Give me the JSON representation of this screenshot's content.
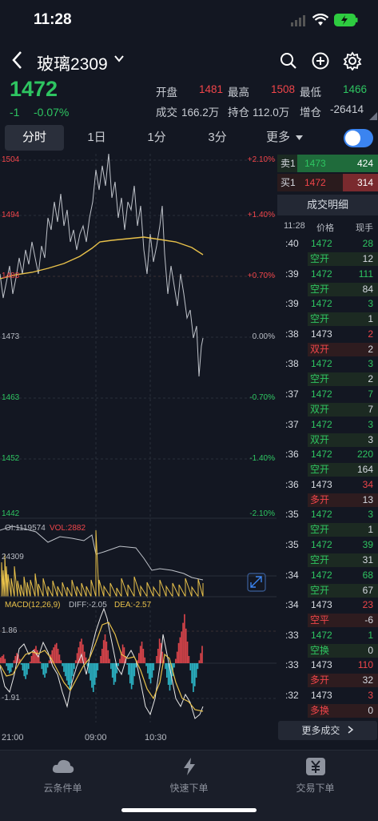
{
  "status": {
    "time": "11:28"
  },
  "header": {
    "title": "玻璃2309"
  },
  "quote": {
    "last": "1472",
    "change": "-1",
    "change_pct": "-0.07%",
    "open_label": "开盘",
    "open": "1481",
    "high_label": "最高",
    "high": "1508",
    "low_label": "最低",
    "low": "1466",
    "vol_label": "成交",
    "vol": "166.2万",
    "oi_label": "持仓",
    "oi": "112.0万",
    "oi_chg_label": "增仓",
    "oi_chg": "-26414"
  },
  "tabs": [
    "分时",
    "1日",
    "1分",
    "3分",
    "更多"
  ],
  "chart": {
    "left_ticks": [
      "1504",
      "1494",
      "1483",
      "1473",
      "1463",
      "1452",
      "1442"
    ],
    "right_ticks": [
      "+2.10%",
      "+1.40%",
      "+0.70%",
      "0.00%",
      "-0.70%",
      "-1.40%",
      "-2.10%"
    ],
    "vol_oi_label": "OI:1119574",
    "vol_label": "VOL:2882",
    "vol_axis": "24309",
    "macd_label": "MACD(12,26,9)",
    "diff_label": "DIFF:-2.05",
    "dea_label": "DEA:-2.57",
    "macd_top": "1.86",
    "macd_bottom": "-1.91",
    "time_labels": [
      "21:00",
      "09:00",
      "10:30"
    ]
  },
  "orderbook": {
    "ask_label": "卖1",
    "ask_price": "1473",
    "ask_vol": "424",
    "bid_label": "买1",
    "bid_price": "1472",
    "bid_vol": "314"
  },
  "trades": {
    "title": "成交明细",
    "time_head": "11:28",
    "price_head": "价格",
    "qty_head": "现手",
    "rows": [
      {
        "t": ":40",
        "p": "1472",
        "pc": "g",
        "q": "28",
        "qc": "g",
        "k": "空开",
        "kc": "g",
        "o": "12"
      },
      {
        "t": ":39",
        "p": "1472",
        "pc": "g",
        "q": "111",
        "qc": "g",
        "k": "空开",
        "kc": "g",
        "o": "84"
      },
      {
        "t": ":39",
        "p": "1472",
        "pc": "g",
        "q": "3",
        "qc": "g",
        "k": "空开",
        "kc": "g",
        "o": "1"
      },
      {
        "t": ":38",
        "p": "1473",
        "pc": "w",
        "q": "2",
        "qc": "r",
        "k": "双开",
        "kc": "r",
        "o": "2"
      },
      {
        "t": ":38",
        "p": "1472",
        "pc": "g",
        "q": "3",
        "qc": "g",
        "k": "空开",
        "kc": "g",
        "o": "2"
      },
      {
        "t": ":37",
        "p": "1472",
        "pc": "g",
        "q": "7",
        "qc": "g",
        "k": "双开",
        "kc": "g",
        "o": "7"
      },
      {
        "t": ":37",
        "p": "1472",
        "pc": "g",
        "q": "3",
        "qc": "g",
        "k": "双开",
        "kc": "g",
        "o": "3"
      },
      {
        "t": ":36",
        "p": "1472",
        "pc": "g",
        "q": "220",
        "qc": "g",
        "k": "空开",
        "kc": "g",
        "o": "164"
      },
      {
        "t": ":36",
        "p": "1473",
        "pc": "w",
        "q": "34",
        "qc": "r",
        "k": "多开",
        "kc": "r",
        "o": "13"
      },
      {
        "t": ":35",
        "p": "1472",
        "pc": "g",
        "q": "3",
        "qc": "g",
        "k": "空开",
        "kc": "g",
        "o": "1"
      },
      {
        "t": ":35",
        "p": "1472",
        "pc": "g",
        "q": "39",
        "qc": "g",
        "k": "空开",
        "kc": "g",
        "o": "31"
      },
      {
        "t": ":34",
        "p": "1472",
        "pc": "g",
        "q": "68",
        "qc": "g",
        "k": "空开",
        "kc": "g",
        "o": "67"
      },
      {
        "t": ":34",
        "p": "1473",
        "pc": "w",
        "q": "23",
        "qc": "r",
        "k": "空平",
        "kc": "r",
        "o": "-6"
      },
      {
        "t": ":33",
        "p": "1472",
        "pc": "g",
        "q": "1",
        "qc": "g",
        "k": "空换",
        "kc": "g",
        "o": "0"
      },
      {
        "t": ":33",
        "p": "1473",
        "pc": "w",
        "q": "110",
        "qc": "r",
        "k": "多开",
        "kc": "r",
        "o": "32"
      },
      {
        "t": ":32",
        "p": "1473",
        "pc": "w",
        "q": "3",
        "qc": "r",
        "k": "多换",
        "kc": "r",
        "o": "0"
      }
    ],
    "more": "更多成交"
  },
  "nav": [
    "云条件单",
    "快速下单",
    "交易下单"
  ],
  "colors": {
    "up": "#f0454a",
    "down": "#2ec561",
    "accent": "#3b84f0",
    "avg": "#e8c14a"
  }
}
